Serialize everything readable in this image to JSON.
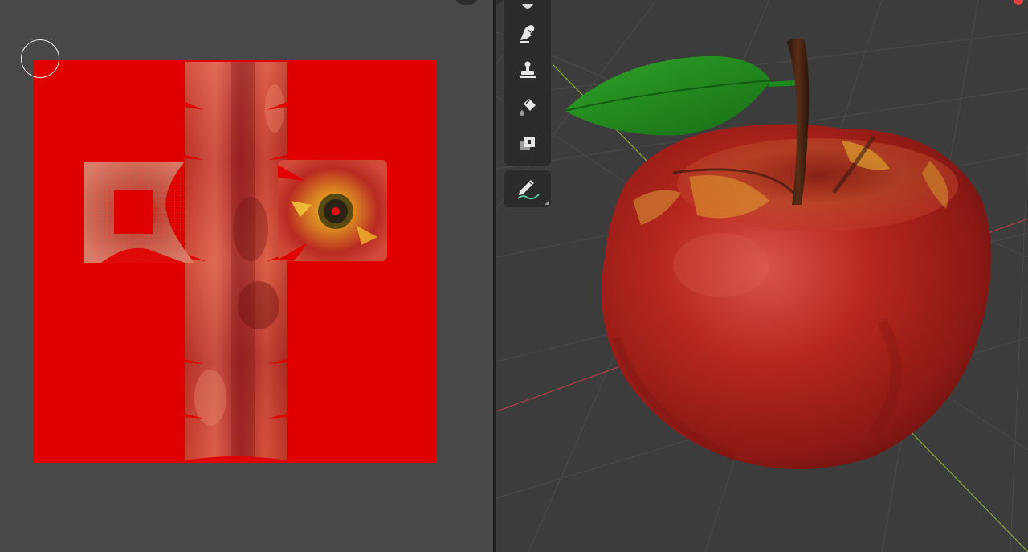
{
  "editors": {
    "left": "image-editor",
    "right": "3d-viewport"
  },
  "image_editor": {
    "background": "#484848",
    "texture_fill_color": "#e00000",
    "brush_cursor_color": "#f2f2f2"
  },
  "toolbar": {
    "tools": [
      {
        "name": "smear",
        "icon": "smear-icon"
      },
      {
        "name": "clone",
        "icon": "clone-icon"
      },
      {
        "name": "fill",
        "icon": "fill-icon"
      },
      {
        "name": "mask",
        "icon": "mask-icon"
      }
    ],
    "annotate_tool": {
      "name": "annotate",
      "icon": "annotate-pencil-icon"
    }
  },
  "viewport": {
    "background": "#3c3c3c",
    "x_axis_color": "#b03e4a",
    "y_axis_color": "#86a83a",
    "object": "apple",
    "apple_color": "#b0201c",
    "leaf_color": "#1f8a1c",
    "stem_color": "#3a1d10"
  }
}
